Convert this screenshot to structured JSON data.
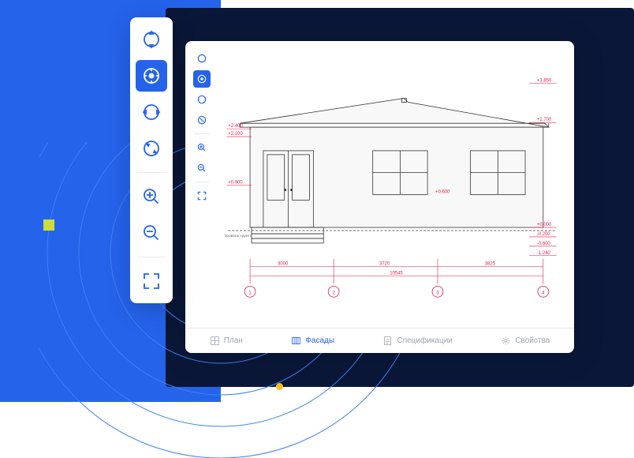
{
  "tabs": {
    "plan": "План",
    "facades": "Фасады",
    "specs": "Спецификации",
    "props": "Свойства"
  },
  "drawing": {
    "ground_label": "Уровень грунта",
    "elevations": {
      "top": "+3.850",
      "ridge": "+2.700",
      "eave_top": "+2.400",
      "eave_bot": "+2.100",
      "porch": "+0.900",
      "window_sill": "+0.600",
      "floor": "+0.000",
      "ground": "-0.200",
      "step1": "-0.600",
      "step2": "-1.240"
    },
    "dims": {
      "seg1": "3000",
      "seg2": "3720",
      "seg3": "3825",
      "total": "10545"
    },
    "axes": {
      "a1": "1",
      "a2": "2",
      "a3": "3",
      "a4": "4"
    }
  }
}
